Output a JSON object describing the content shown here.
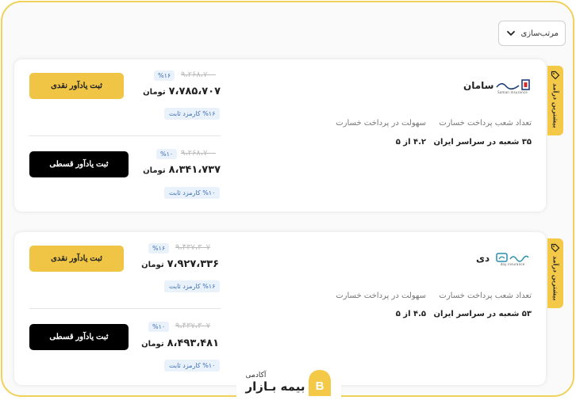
{
  "sort": {
    "label": "مرتب‌سازی"
  },
  "tab_label": "بیشترین درآمد",
  "currency": "تومان",
  "labels": {
    "branches": "تعداد شعب پرداخت خسارت",
    "ease": "سهولت در پرداخت خسارت",
    "cash_button": "ثبت یادآور نقدی",
    "installment_button": "ثبت یادآور قسطی"
  },
  "cards": [
    {
      "insurer": "سامان",
      "logo_sub": "Saman Insurance",
      "branches": "۳۵ شعبه در سراسر ایران",
      "ease": "۴.۲ از ۵",
      "cash": {
        "old_price": "۹،۲۶۸،۷۰۰",
        "discount": "%۱۶",
        "price": "۷،۷۸۵،۷۰۷",
        "fee": "%۱۶ کارمزد ثابت"
      },
      "installment": {
        "old_price": "۹،۲۶۸،۷۰۰",
        "discount": "%۱۰",
        "price": "۸،۳۴۱،۷۳۷",
        "fee": "%۱۰ کارمزد ثابت"
      }
    },
    {
      "insurer": "دی",
      "logo_sub": "day insurance",
      "branches": "۵۳ شعبه در سراسر ایران",
      "ease": "۴.۵ از ۵",
      "cash": {
        "old_price": "۹،۴۳۷،۳۰۷",
        "discount": "%۱۶",
        "price": "۷،۹۲۷،۳۳۶",
        "fee": "%۱۶ کارمزد ثابت"
      },
      "installment": {
        "old_price": "۹،۴۳۷،۳۰۷",
        "discount": "%۱۰",
        "price": "۸،۴۹۳،۴۸۱",
        "fee": "%۱۰ کارمزد ثابت"
      }
    }
  ],
  "footer": {
    "small": "آکادمی",
    "big": "بیمه بـازار",
    "badge_letter": "B"
  },
  "colors": {
    "accent": "#f4c948",
    "border": "#f0d15a",
    "badge_text": "#3d6fb8"
  }
}
